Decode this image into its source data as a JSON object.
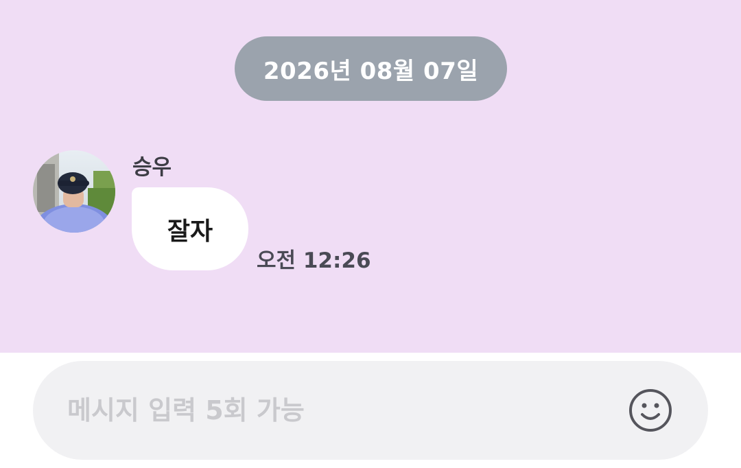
{
  "chat": {
    "date_separator": "2026년 08월 07일",
    "message": {
      "sender": "승우",
      "text": "잘자",
      "time": "오전 12:26"
    }
  },
  "composer": {
    "placeholder": "메시지 입력 5회 가능",
    "emoji_icon": "smiley-icon"
  },
  "colors": {
    "chat_background": "#f0ddf5",
    "date_pill": "#9ba3ad",
    "bubble": "#ffffff",
    "input_background": "#f1f1f3"
  }
}
